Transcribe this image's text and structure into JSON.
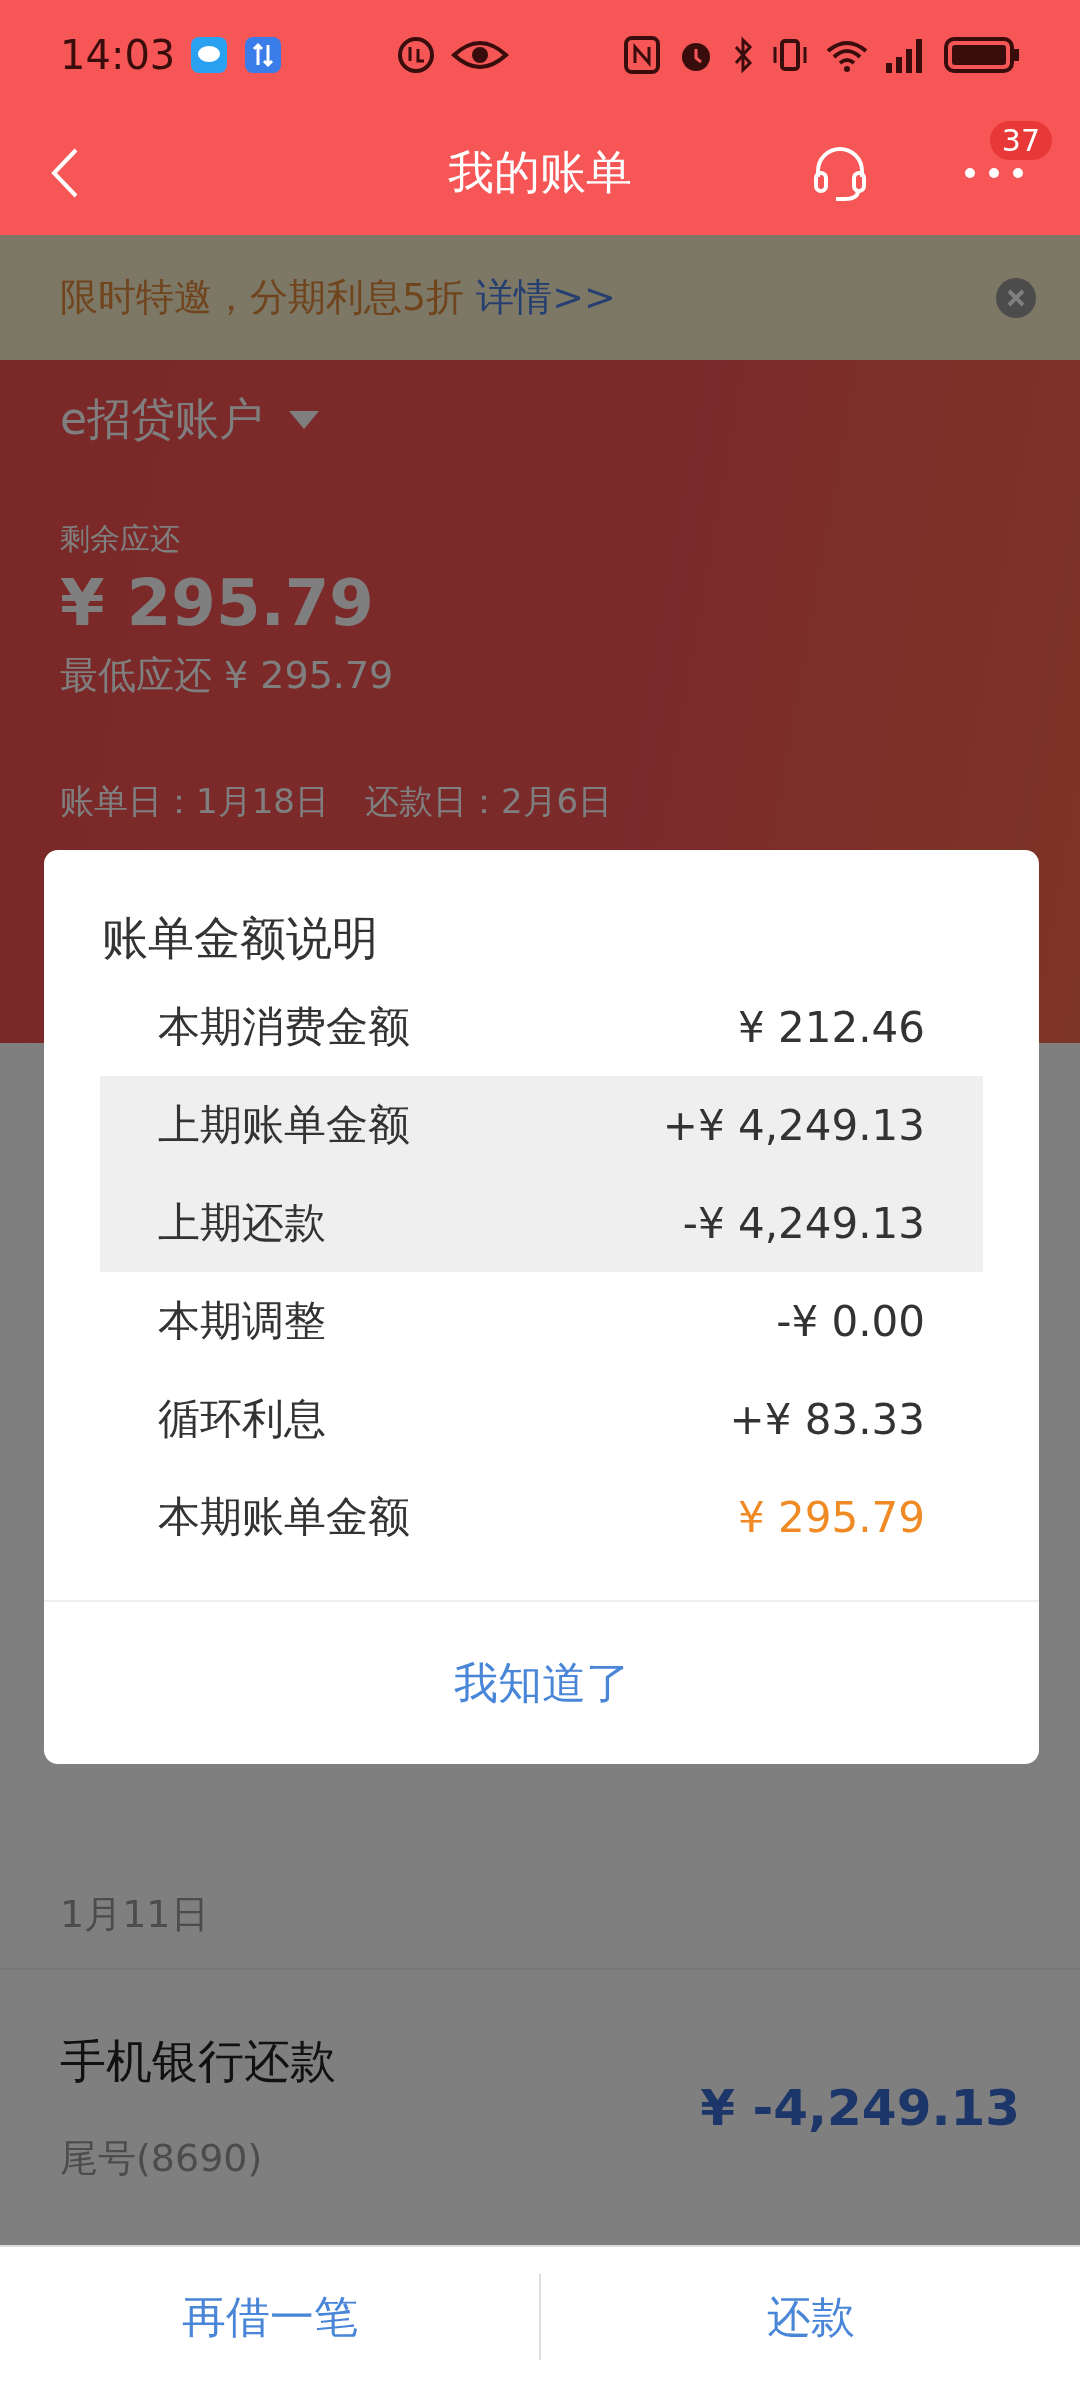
{
  "status_bar": {
    "time": "14:03"
  },
  "nav": {
    "title": "我的账单",
    "badge": "37"
  },
  "promo": {
    "text": "限时特邀，分期利息5折",
    "link": "详情>>"
  },
  "account": {
    "name": "e招贷账户",
    "remaining_label": "剩余应还",
    "remaining": "¥ 295.79",
    "minimum": "最低应还 ¥ 295.79",
    "bill_day": "账单日：1月18日",
    "due_day": "还款日：2月6日"
  },
  "dialog": {
    "title": "账单金额说明",
    "button": "我知道了",
    "rows": [
      {
        "label": "本期消费金额",
        "value": "¥ 212.46",
        "shaded": false,
        "kind": "normal"
      },
      {
        "label": "上期账单金额",
        "value": "+¥ 4,249.13",
        "shaded": true,
        "kind": "normal"
      },
      {
        "label": "上期还款",
        "value": "-¥ 4,249.13",
        "shaded": true,
        "kind": "normal"
      },
      {
        "label": "本期调整",
        "value": "-¥ 0.00",
        "shaded": false,
        "kind": "normal"
      },
      {
        "label": "循环利息",
        "value": "+¥ 83.33",
        "shaded": false,
        "kind": "normal"
      },
      {
        "label": "本期账单金额",
        "value": "¥ 295.79",
        "shaded": false,
        "kind": "total"
      }
    ]
  },
  "records": [
    {
      "date": "1月11日",
      "title": "手机银行还款",
      "card": "尾号(8690)",
      "amount": "¥ -4,249.13"
    }
  ],
  "bottom_bar": {
    "buttons": [
      "再借一笔",
      "还款"
    ]
  }
}
